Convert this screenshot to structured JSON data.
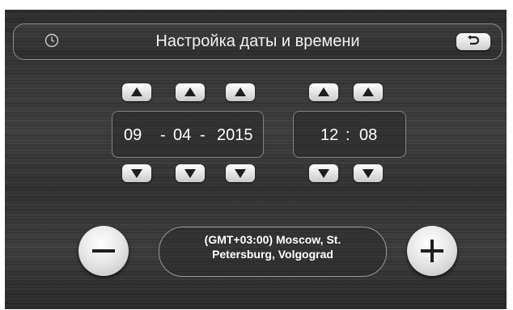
{
  "header": {
    "title": "Настройка даты и времени",
    "left_icon": "clock-icon",
    "back_icon": "back-arrow-icon"
  },
  "date": {
    "day": "09",
    "separator_1": "-",
    "month": "04",
    "separator_2": "-",
    "year": "2015"
  },
  "time": {
    "hour": "12",
    "separator": ":",
    "minute": "08"
  },
  "timezone": {
    "line1": "(GMT+03:00) Moscow, St.",
    "line2": "Petersburg, Volgograd"
  },
  "controls": {
    "up_icon": "triangle-up-icon",
    "down_icon": "triangle-down-icon",
    "minus_icon": "minus-icon",
    "plus_icon": "plus-icon"
  },
  "colors": {
    "background": "#333333",
    "text": "#ffffff",
    "button": "#e8e8e8"
  }
}
